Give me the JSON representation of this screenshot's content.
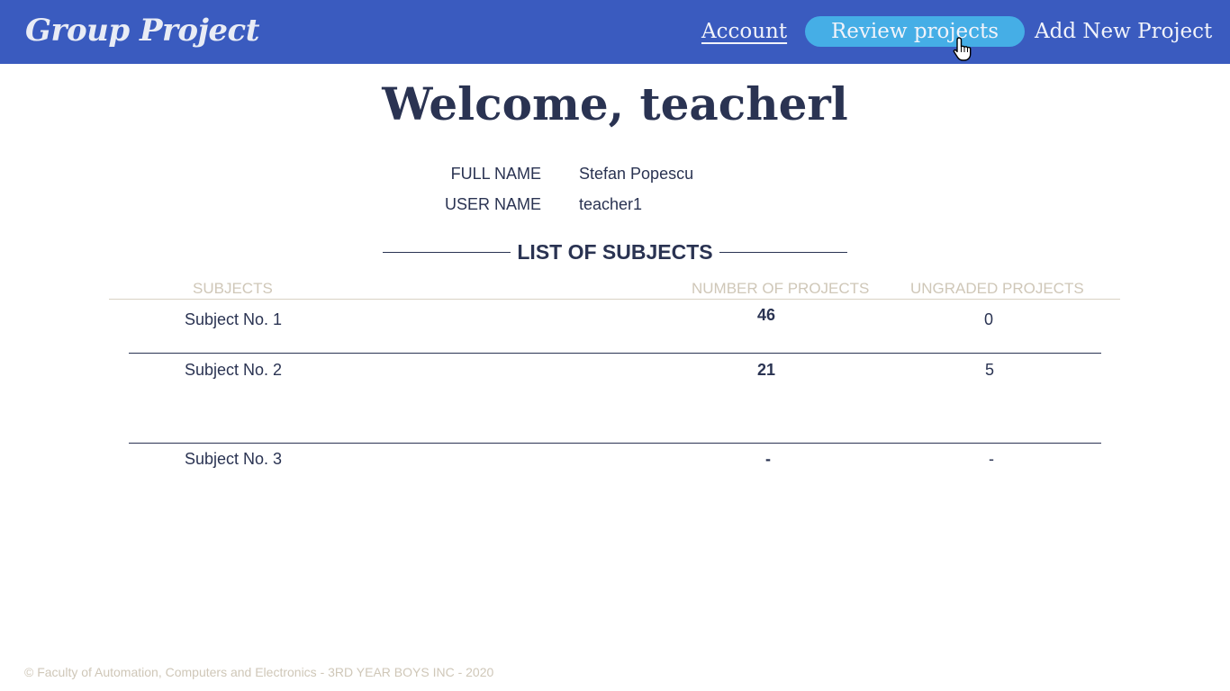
{
  "navbar": {
    "logo": "Group Project",
    "links": {
      "account": "Account",
      "review": "Review projects",
      "add": "Add New Project"
    },
    "colors": {
      "background": "#3a5bbf",
      "active_pill": "#45aee6"
    }
  },
  "welcome": {
    "title": "Welcome, teacherl"
  },
  "profile": {
    "full_name_label": "FULL NAME",
    "full_name_value": "Stefan Popescu",
    "user_name_label": "USER NAME",
    "user_name_value": "teacher1"
  },
  "subjects_section": {
    "title": "LIST OF SUBJECTS",
    "columns": [
      "SUBJECTS",
      "NUMBER OF PROJECTS",
      "UNGRADED PROJECTS"
    ],
    "rows": [
      {
        "subject": "Subject No. 1",
        "projects": "46",
        "ungraded": "0"
      },
      {
        "subject": "Subject No. 2",
        "projects": "21",
        "ungraded": "5"
      },
      {
        "subject": "Subject No. 3",
        "projects": "-",
        "ungraded": "-"
      }
    ]
  },
  "footer": {
    "text": "© Faculty of Automation, Computers and Electronics - 3RD YEAR BOYS INC - 2020"
  },
  "icons": {
    "cursor": "hand-pointer-icon"
  }
}
